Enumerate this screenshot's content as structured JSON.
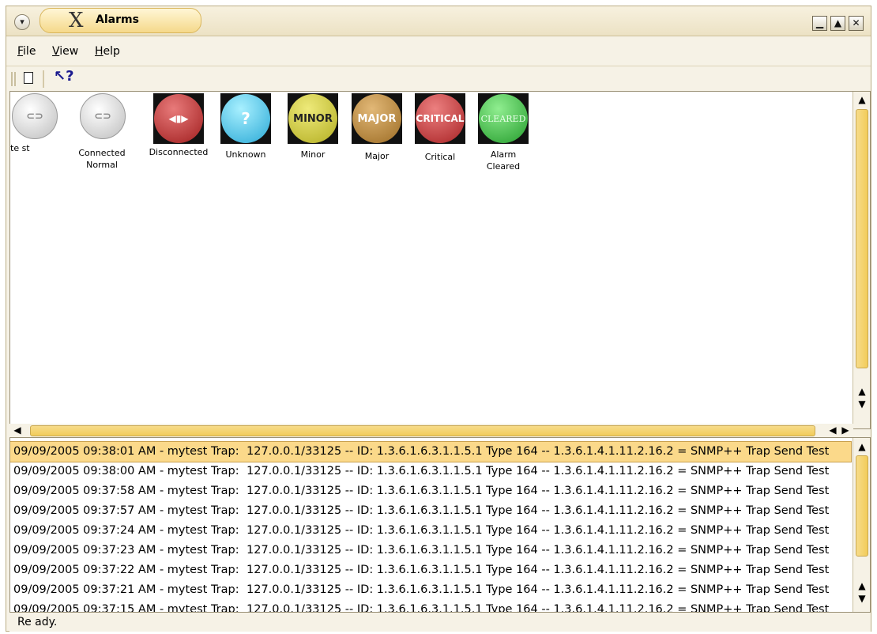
{
  "window": {
    "title": "Alarms",
    "x_logo": "X",
    "menu_arrow": "▾",
    "minimize": "▁",
    "maximize": "▲",
    "close": "✕"
  },
  "menubar": {
    "file": {
      "u": "F",
      "rest": "ile"
    },
    "view": {
      "u": "V",
      "rest": "iew"
    },
    "help": {
      "u": "H",
      "rest": "elp"
    }
  },
  "toolbar": {
    "new_icon": "new-document-icon",
    "help_icon": "help-pointer-icon",
    "help_glyph": "↖?"
  },
  "icons": [
    {
      "label": "te st"
    },
    {
      "label1": "Connected",
      "label2": "Normal"
    },
    {
      "label": "Disconnected"
    },
    {
      "label": "Unknown",
      "glyph": "?"
    },
    {
      "label": "Minor",
      "text": "MINOR",
      "color": "#c9c42f"
    },
    {
      "label": "Major",
      "text": "MAJOR",
      "color": "#b88935"
    },
    {
      "label": "Critical",
      "text": "CRITICAL",
      "color": "#c0393a"
    },
    {
      "label1": "Alarm",
      "label2": "Cleared",
      "text": "CLEARED",
      "color": "#2fa03a"
    }
  ],
  "log": {
    "message": "127.0.0.1/33125 -- ID: 1.3.6.1.6.3.1.1.5.1 Type 164 -- 1.3.6.1.4.1.11.2.16.2 = SNMP++ Trap Send Test",
    "rows": [
      "09/09/2005 09:38:01 AM - mytest Trap:",
      "09/09/2005 09:38:00 AM - mytest Trap:",
      "09/09/2005 09:37:58 AM - mytest Trap:",
      "09/09/2005 09:37:57 AM - mytest Trap:",
      "09/09/2005 09:37:24 AM - mytest Trap:",
      "09/09/2005 09:37:23 AM - mytest Trap:",
      "09/09/2005 09:37:22 AM - mytest Trap:",
      "09/09/2005 09:37:21 AM - mytest Trap:",
      "09/09/2005 09:37:15 AM - mytest Trap:"
    ]
  },
  "scroll": {
    "up": "▲",
    "down": "▼",
    "left": "◀",
    "right": "▶"
  },
  "status": {
    "text": "Re ady."
  }
}
